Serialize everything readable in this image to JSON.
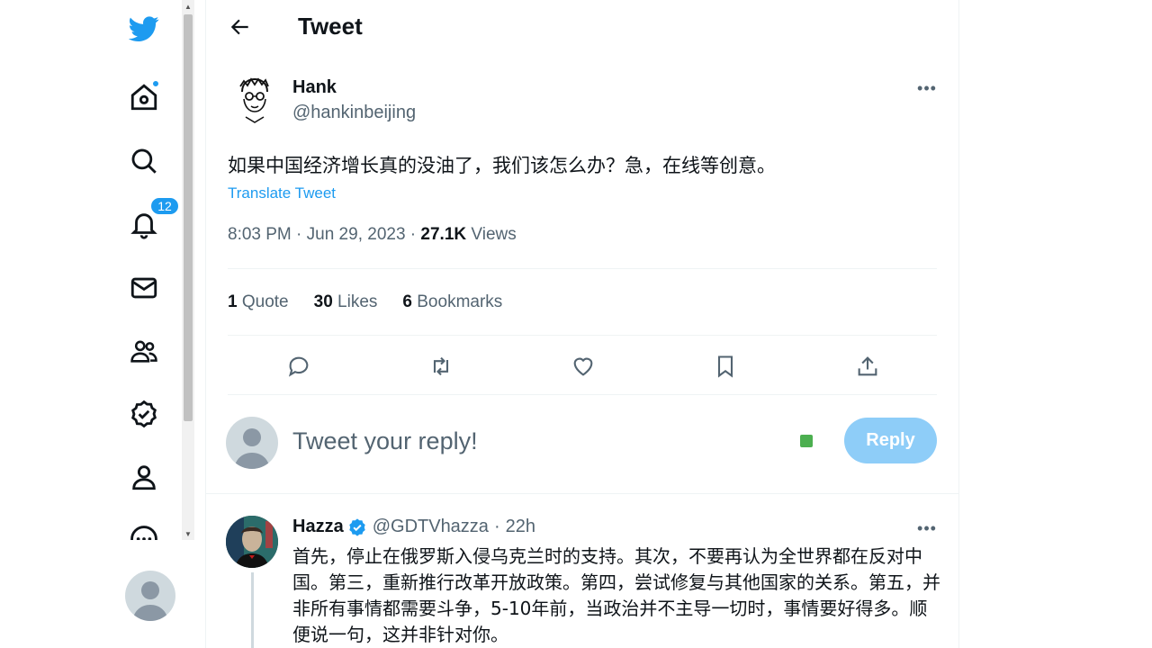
{
  "nav": {
    "items": [
      {
        "name": "twitter-logo",
        "icon": "twitter-bird-icon"
      },
      {
        "name": "home",
        "icon": "home-icon",
        "has_dot": true
      },
      {
        "name": "explore",
        "icon": "search-icon"
      },
      {
        "name": "notifications",
        "icon": "bell-icon",
        "badge": "12"
      },
      {
        "name": "messages",
        "icon": "mail-icon"
      },
      {
        "name": "communities",
        "icon": "people-icon"
      },
      {
        "name": "verified",
        "icon": "verified-badge-icon"
      },
      {
        "name": "profile",
        "icon": "person-icon"
      },
      {
        "name": "more",
        "icon": "more-circle-icon"
      }
    ]
  },
  "header": {
    "title": "Tweet"
  },
  "tweet": {
    "author_name": "Hank",
    "author_handle": "@hankinbeijing",
    "text": "如果中国经济增长真的没油了，我们该怎么办？急，在线等创意。",
    "translate_label": "Translate Tweet",
    "timestamp": "8:03 PM · Jun 29, 2023 · ",
    "views_count": "27.1K",
    "views_label": " Views",
    "stats": {
      "quotes_count": "1",
      "quotes_label": " Quote",
      "likes_count": "30",
      "likes_label": " Likes",
      "bookmarks_count": "6",
      "bookmarks_label": " Bookmarks"
    }
  },
  "composer": {
    "placeholder": "Tweet your reply!",
    "button_label": "Reply"
  },
  "reply": {
    "author_name": "Hazza",
    "author_handle": "@GDTVhazza",
    "separator": "·",
    "time": "22h",
    "text": "首先，停止在俄罗斯入侵乌克兰时的支持。其次，不要再认为全世界都在反对中国。第三，重新推行改革开放政策。第四，尝试修复与其他国家的关系。第五，并非所有事情都需要斗争，5-10年前，当政治并不主导一切时，事情要好得多。顺便说一句，这并非针对你。"
  },
  "colors": {
    "accent": "#1d9bf0",
    "reply_button_disabled": "#8ecdf8",
    "secondary_text": "#536471"
  }
}
